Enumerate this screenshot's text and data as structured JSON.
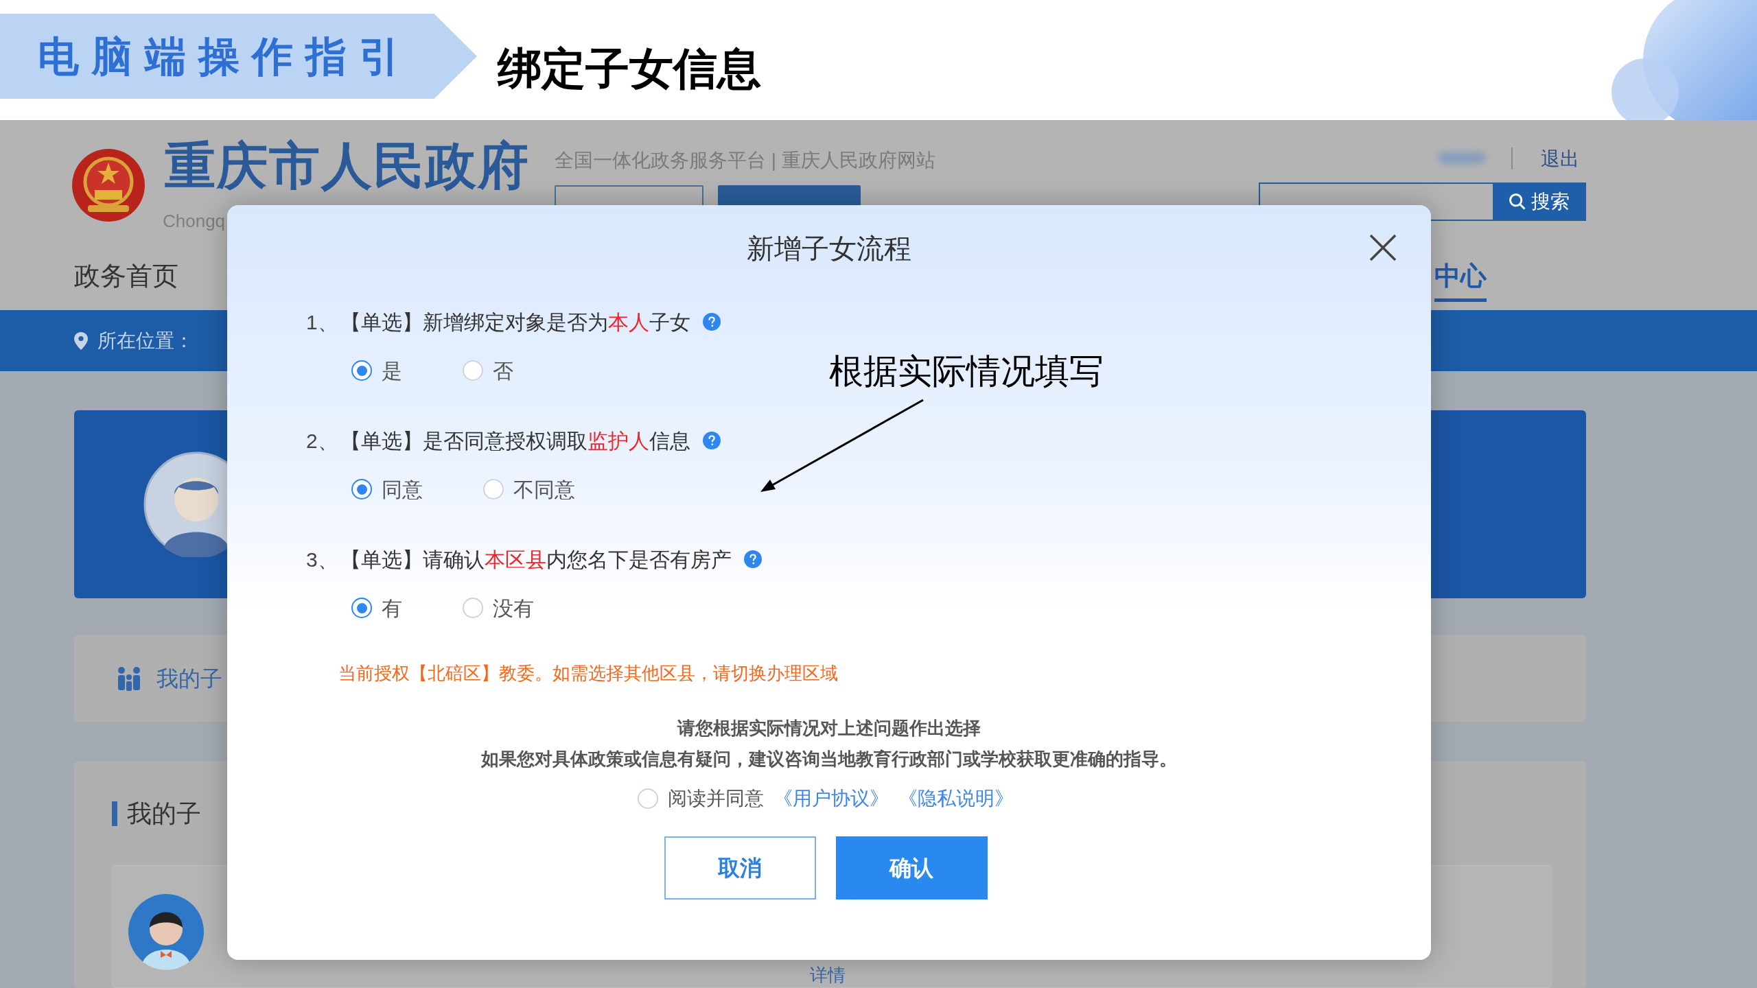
{
  "slide": {
    "section_label": "电脑端操作指引",
    "title": "绑定子女信息"
  },
  "site": {
    "name": "重庆市人民政府",
    "name_en": "Chongq",
    "platform": "全国一体化政务服务平台 | 重庆人民政府网站",
    "logout": "退出",
    "search": {
      "button": "搜索"
    },
    "nav": [
      {
        "label": "政务首页",
        "selected": false
      },
      {
        "label": "中心",
        "selected": true
      }
    ],
    "location_label": "所在位置：",
    "children_tab": "我的子",
    "children_section": "我的子",
    "details_link": "详情"
  },
  "modal": {
    "title": "新增子女流程",
    "questions": [
      {
        "number": "1、",
        "prefix": "【单选】新增绑定对象是否为",
        "highlight": "本人",
        "suffix": "子女",
        "options": [
          {
            "label": "是",
            "selected": true
          },
          {
            "label": "否",
            "selected": false
          }
        ]
      },
      {
        "number": "2、",
        "prefix": "【单选】是否同意授权调取",
        "highlight": "监护人",
        "suffix": "信息",
        "options": [
          {
            "label": "同意",
            "selected": true
          },
          {
            "label": "不同意",
            "selected": false
          }
        ]
      },
      {
        "number": "3、",
        "prefix": "【单选】请确认",
        "highlight": "本区县",
        "suffix": "内您名下是否有房产",
        "options": [
          {
            "label": "有",
            "selected": true
          },
          {
            "label": "没有",
            "selected": false
          }
        ]
      }
    ],
    "notice": "当前授权【北碚区】教委。如需选择其他区县，请切换办理区域",
    "hints": [
      "请您根据实际情况对上述问题作出选择",
      "如果您对具体政策或信息有疑问，建议咨询当地教育行政部门或学校获取更准确的指导。"
    ],
    "agreement": {
      "checked": false,
      "label": "阅读并同意",
      "links": [
        "《用户协议》",
        "《隐私说明》"
      ]
    },
    "buttons": [
      {
        "kind": "secondary",
        "label": "取消"
      },
      {
        "kind": "primary",
        "label": "确认"
      }
    ]
  },
  "annotation": "根据实际情况填写"
}
